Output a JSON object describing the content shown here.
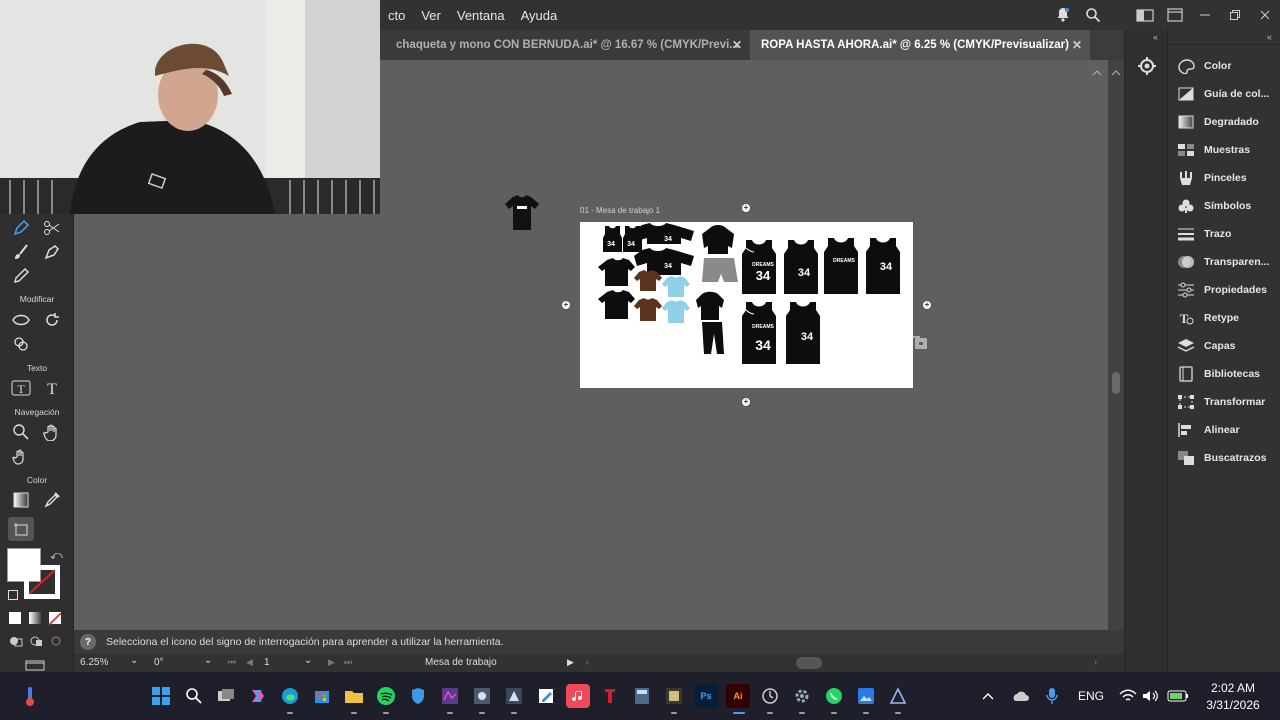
{
  "menubar": {
    "items": [
      "cto",
      "Ver",
      "Ventana",
      "Ayuda"
    ]
  },
  "tabs": [
    {
      "label": "chaqueta y mono CON BERNUDA.ai* @ 16.67 % (CMYK/Previ...",
      "active": false
    },
    {
      "label": "ROPA HASTA AHORA.ai* @ 6.25 % (CMYK/Previsualizar)",
      "active": true
    }
  ],
  "toolbar": {
    "sections": [
      "Modificar",
      "Texto",
      "Navegación",
      "Color"
    ]
  },
  "artboard": {
    "label": "01 - Mesa de trabajo 1",
    "jersey_text_number": "34",
    "jersey_text_brand": "DREAMS"
  },
  "panels": [
    {
      "label": "Color",
      "icon": "color-icon"
    },
    {
      "label": "Guía de col...",
      "icon": "color-guide-icon"
    },
    {
      "label": "Degradado",
      "icon": "gradient-icon"
    },
    {
      "label": "Muestras",
      "icon": "swatches-icon"
    },
    {
      "label": "Pinceles",
      "icon": "brushes-icon"
    },
    {
      "label": "Símbolos",
      "icon": "symbols-icon"
    },
    {
      "label": "Trazo",
      "icon": "stroke-icon"
    },
    {
      "label": "Transparen...",
      "icon": "transparency-icon"
    },
    {
      "label": "Propiedades",
      "icon": "properties-icon"
    },
    {
      "label": "Retype",
      "icon": "retype-icon"
    },
    {
      "label": "Capas",
      "icon": "layers-icon"
    },
    {
      "label": "Bibliotecas",
      "icon": "libraries-icon"
    },
    {
      "label": "Transformar",
      "icon": "transform-icon"
    },
    {
      "label": "Alinear",
      "icon": "align-icon"
    },
    {
      "label": "Buscatrazos",
      "icon": "pathfinder-icon"
    }
  ],
  "hint": {
    "text": "Selecciona el icono del signo de interrogación para aprender a utilizar la herramienta."
  },
  "status": {
    "zoom": "6.25%",
    "rotation": "0°",
    "artboard_number": "1",
    "artboard_mode": "Mesa de trabajo"
  },
  "taskbar": {
    "language": "ENG",
    "time": "2:02 AM",
    "date": "3/31/2026",
    "illustrator_badge": "Ai",
    "photoshop_badge": "Ps"
  },
  "colors": {
    "accent": "#4a9de8",
    "canvas": "#5f5f5f",
    "panel": "#323232",
    "taskbar": "#1f1f2b"
  }
}
